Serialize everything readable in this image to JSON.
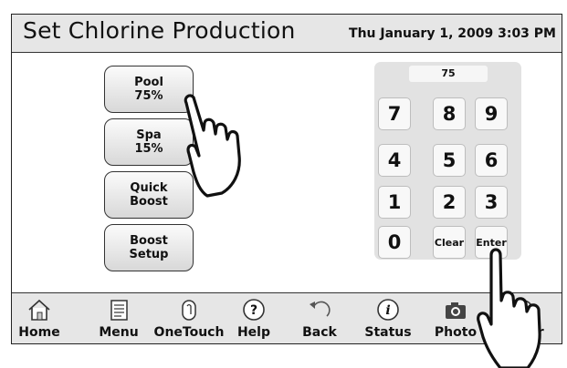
{
  "header": {
    "title": "Set Chlorine Production",
    "datetime": "Thu January 1, 2009  3:03 PM"
  },
  "buttons": {
    "pool": "Pool\n75%",
    "spa": "Spa\n15%",
    "quick_boost": "Quick\nBoost",
    "boost_setup": "Boost\nSetup"
  },
  "keypad": {
    "display_value": "75",
    "keys": {
      "k7": "7",
      "k8": "8",
      "k9": "9",
      "k4": "4",
      "k5": "5",
      "k6": "6",
      "k1": "1",
      "k2": "2",
      "k3": "3",
      "k0": "0",
      "clear": "Clear",
      "enter": "Enter"
    }
  },
  "nav": {
    "items": [
      {
        "label": "Home",
        "icon": "home-icon"
      },
      {
        "label": "Menu",
        "icon": "menu-icon"
      },
      {
        "label": "OneTouch",
        "icon": "onetouch-icon"
      },
      {
        "label": "Help",
        "icon": "help-icon"
      },
      {
        "label": "Back",
        "icon": "back-icon"
      },
      {
        "label": "Status",
        "icon": "status-icon"
      },
      {
        "label": "Photo",
        "icon": "camera-icon"
      },
      {
        "label": "Timer",
        "icon": "timer-icon"
      }
    ]
  },
  "overlay": {
    "pointer_icon": "pointing-hand-icon"
  }
}
